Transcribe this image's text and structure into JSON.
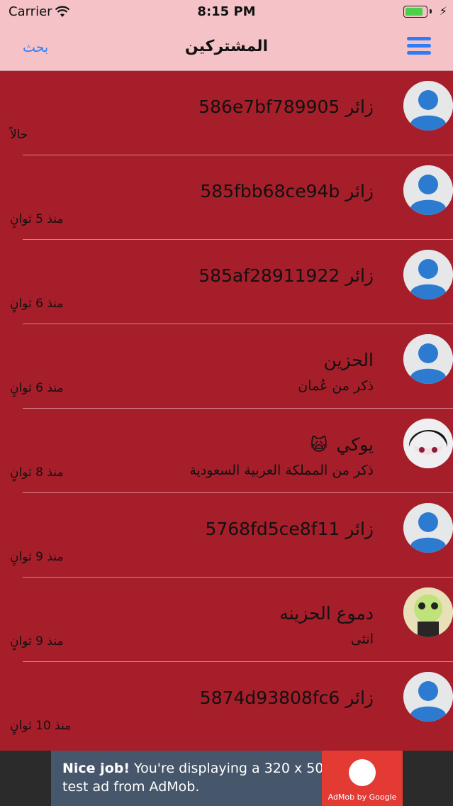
{
  "status": {
    "carrier": "Carrier",
    "time": "8:15 PM",
    "battery_level": 0.85
  },
  "nav": {
    "title": "المشتركين",
    "search_label": "بحث",
    "menu_icon": "hamburger-menu-icon"
  },
  "colors": {
    "list_bg": "#a61e2a",
    "nav_bg": "#f5c3c7",
    "accent": "#2f7df6"
  },
  "members": [
    {
      "name": "زائر 586e7bf789905",
      "subtitle": "",
      "time": "حالاً",
      "avatar": "default"
    },
    {
      "name": "زائر 585fbb68ce94b",
      "subtitle": "",
      "time": "منذ 5 ثوانٍ",
      "avatar": "default"
    },
    {
      "name": "زائر 585af28911922",
      "subtitle": "",
      "time": "منذ 6 ثوانٍ",
      "avatar": "default"
    },
    {
      "name": "الحزين",
      "subtitle": "ذكر من عُمان",
      "time": "منذ 6 ثوانٍ",
      "avatar": "default"
    },
    {
      "name": "يوكي",
      "subtitle": "ذكر من المملكة العربية السعودية",
      "time": "منذ 8 ثوانٍ",
      "avatar": "anime"
    },
    {
      "name": "زائر 5768fd5ce8f11",
      "subtitle": "",
      "time": "منذ 9 ثوانٍ",
      "avatar": "default"
    },
    {
      "name": "دموع الحزينه",
      "subtitle": "انثى",
      "time": "منذ 9 ثوانٍ",
      "avatar": "panda"
    },
    {
      "name": "زائر 5874d93808fc6",
      "subtitle": "",
      "time": "منذ 10 ثوانٍ",
      "avatar": "default"
    }
  ],
  "ad": {
    "bold": "Nice job!",
    "text": " You're displaying a 320 x 50 test ad from AdMob.",
    "logo_text": "AdMob by Google"
  }
}
